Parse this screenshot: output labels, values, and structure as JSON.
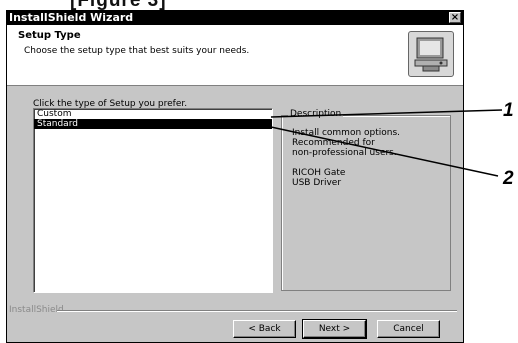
{
  "page_caption": "[Figure 3]",
  "window": {
    "title": "InstallShield Wizard",
    "close_glyph": "×"
  },
  "header": {
    "title": "Setup Type",
    "subtitle": "Choose the setup type that best suits your needs.",
    "icon": "installer-computer-icon"
  },
  "prompt": "Click the type of Setup you prefer.",
  "setup_list": [
    {
      "label": "Custom",
      "selected": false
    },
    {
      "label": "Standard",
      "selected": true
    }
  ],
  "description": {
    "label": "Description",
    "text": "Install common options.\nRecommended for\nnon-professional users.\n\nRICOH Gate\nUSB Driver"
  },
  "footer_brand": "InstallShield",
  "buttons": {
    "back": "< Back",
    "next": "Next >",
    "cancel": "Cancel"
  },
  "callouts": [
    "1",
    "2"
  ]
}
